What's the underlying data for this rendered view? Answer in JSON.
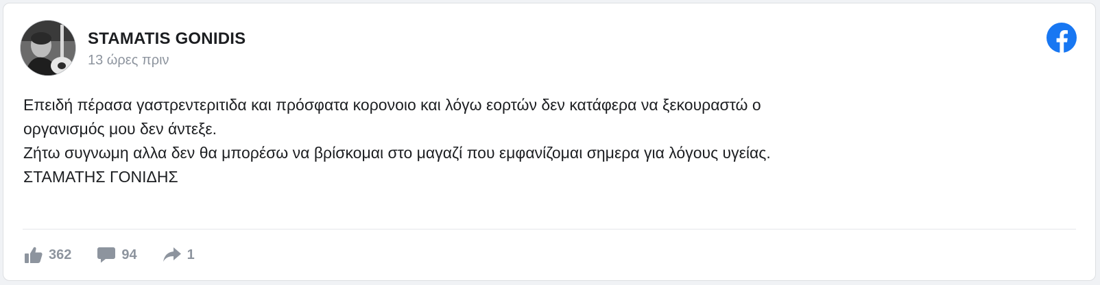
{
  "post": {
    "author": "STAMATIS GONIDIS",
    "time": "13 ώρες πριν",
    "lines": [
      "Επειδή πέρασα γαστρεντεριτιδα και πρόσφατα κορονοιο και λόγω εορτών δεν κατάφερα να ξεκουραστώ ο",
      "οργανισμός μου δεν άντεξε.",
      "Ζήτω συγνωμη αλλα δεν θα μπορέσω να βρίσκομαι στο μαγαζί που εμφανίζομαι σημερα για λόγους υγείας.",
      "ΣΤΑΜΑΤΗΣ ΓΟΝΙΔΗΣ"
    ]
  },
  "stats": {
    "likes": "362",
    "comments": "94",
    "shares": "1"
  },
  "icons": {
    "platform": "facebook-icon",
    "like": "thumbs-up-icon",
    "comment": "comment-bubble-icon",
    "share": "share-arrow-icon"
  },
  "colors": {
    "facebook_blue": "#1877f2",
    "muted_gray": "#8d949e",
    "text": "#1c1e21"
  }
}
